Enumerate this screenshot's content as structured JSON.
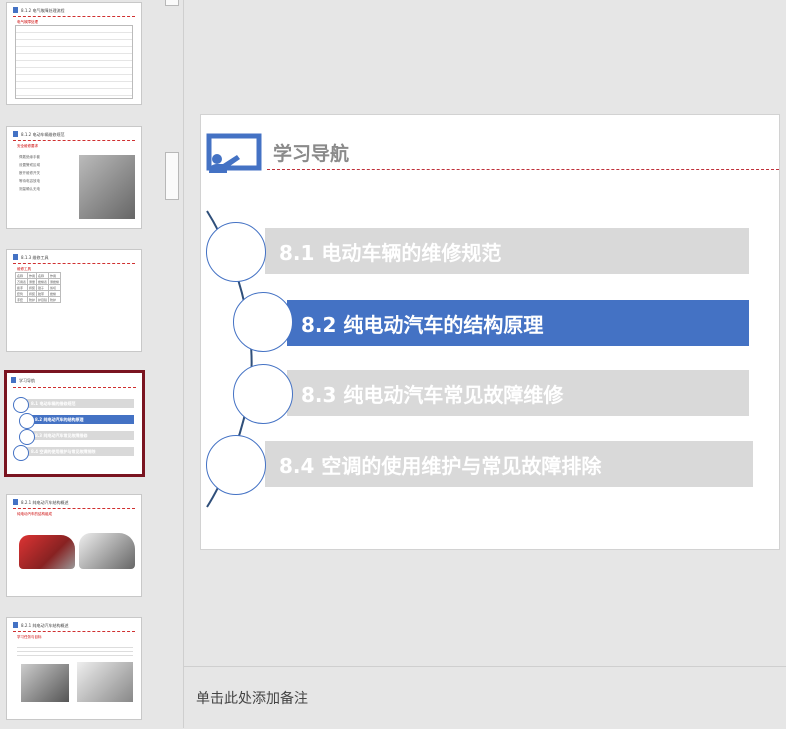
{
  "thumbnails": [
    {
      "title": "8.1.2 电气故障处理流程",
      "subtitle": "电气故障处理"
    },
    {
      "title": "8.1.2 电动车辆维修规范",
      "subtitle": "安全维修要求",
      "bullets": [
        "佩戴绝缘手套",
        "设置警戒区域",
        "断开维修开关",
        "等待电容放电",
        "测量确认无电"
      ]
    },
    {
      "title": "8.1.3 维修工具",
      "subtitle": "维修工具",
      "table": [
        [
          "名称",
          "作用",
          "名称",
          "作用"
        ],
        [
          "万用表",
          "测量",
          "绝缘表",
          "测绝缘"
        ],
        [
          "扳手",
          "拆装",
          "钳子",
          "剪切"
        ],
        [
          "套筒",
          "拆装",
          "胶带",
          "绝缘"
        ],
        [
          "手套",
          "防护",
          "护目镜",
          "防护"
        ]
      ]
    },
    {
      "title": "学习导航",
      "selected": true,
      "items": [
        "8.1 电动车辆的维修规范",
        "8.2 纯电动汽车的结构原理",
        "8.3 纯电动汽车常见故障维修",
        "8.4 空调的使用维护与常见故障排除"
      ]
    },
    {
      "title": "8.2.1 纯电动汽车结构概述",
      "subtitle": "纯电动汽车的结构组成"
    },
    {
      "title": "8.2.1 纯电动汽车结构概述",
      "subtitle": "学习任务与目标"
    }
  ],
  "slide": {
    "title": "学习导航",
    "items": [
      "8.1 电动车辆的维修规范",
      "8.2 纯电动汽车的结构原理",
      "8.3 纯电动汽车常见故障维修",
      "8.4 空调的使用维护与常见故障排除"
    ],
    "active_index": 1
  },
  "notes_placeholder": "单击此处添加备注",
  "colors": {
    "accent": "#4472c4",
    "inactive_bar": "#d9d9d9",
    "selected_thumb_border": "#7a1420",
    "divider": "#c0303a"
  }
}
